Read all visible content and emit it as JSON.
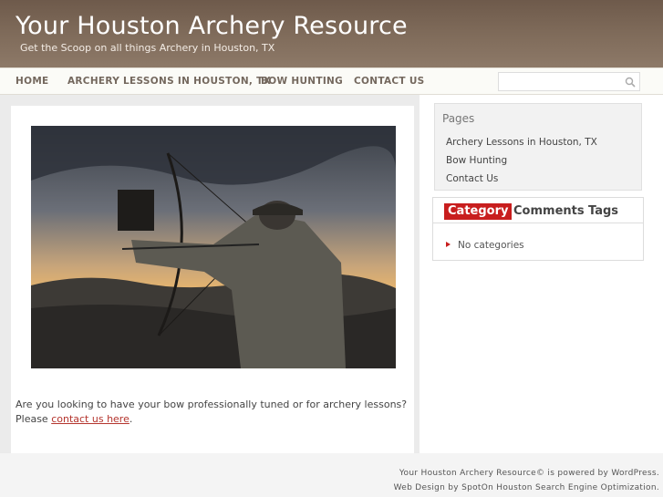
{
  "header": {
    "site_title": "Your Houston Archery Resource",
    "site_description": "Get the Scoop on all things Archery in Houston, TX"
  },
  "nav": {
    "items": [
      {
        "label": "HOME"
      },
      {
        "label": "ARCHERY LESSONS IN HOUSTON, TX"
      },
      {
        "label": "BOW HUNTING"
      },
      {
        "label": "CONTACT US"
      }
    ]
  },
  "search": {
    "value": "",
    "placeholder": ""
  },
  "post": {
    "text_before_link": "Are you looking to have your bow professionally tuned or for archery lessons? Please ",
    "link_text": "contact us here",
    "text_after_link": "."
  },
  "sidebar": {
    "pages_title": "Pages",
    "pages": [
      {
        "label": "Archery Lessons in Houston, TX"
      },
      {
        "label": "Bow Hunting"
      },
      {
        "label": "Contact Us"
      }
    ],
    "tabs": [
      {
        "label": "Category"
      },
      {
        "label": "Comments"
      },
      {
        "label": "Tags"
      }
    ],
    "category_item": "No categories"
  },
  "footer": {
    "line1": "Your Houston Archery Resource© is powered by WordPress.",
    "line2": "Web Design by SpotOn Houston Search Engine Optimization."
  },
  "colors": {
    "header_brown": "#7f6b5a",
    "accent_red": "#c81e1e",
    "link_red": "#b4342d"
  },
  "icons": {
    "search": "magnifier-icon",
    "bullet": "triangle-right-icon"
  }
}
